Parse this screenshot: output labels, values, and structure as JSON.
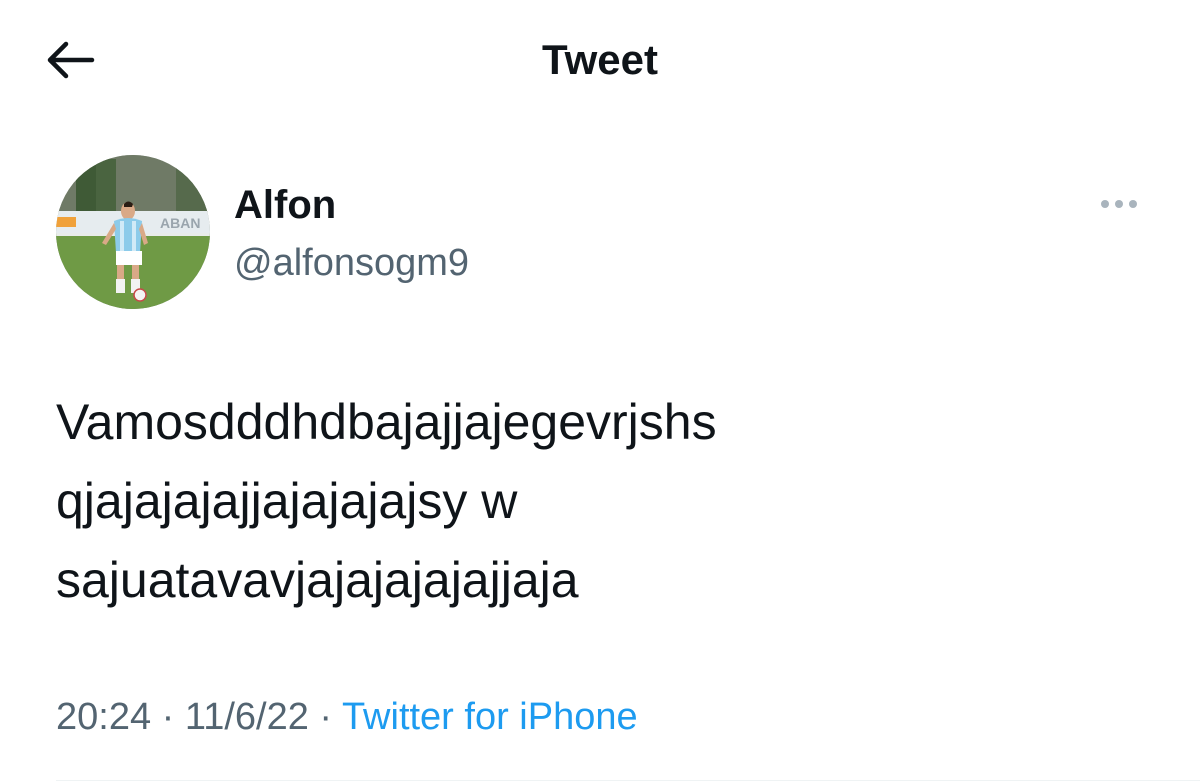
{
  "header": {
    "title": "Tweet",
    "back_icon": "arrow-left-icon"
  },
  "tweet": {
    "author": {
      "display_name": "Alfon",
      "handle": "@alfonsogm9",
      "avatar_icon": "profile-photo-soccer-player"
    },
    "more_icon": "more-horizontal-icon",
    "text": "Vamosdddhdbajajjajegevrjshs\nqjajajajajjajajajajsy w\nsajuatavavjajajajajajjaja",
    "time": "20:24",
    "separator": "·",
    "date": "11/6/22",
    "source": "Twitter for iPhone"
  },
  "colors": {
    "text_primary": "#0f1419",
    "text_secondary": "#536471",
    "link": "#1d9bf0",
    "more_dots": "#a9b4bd"
  }
}
